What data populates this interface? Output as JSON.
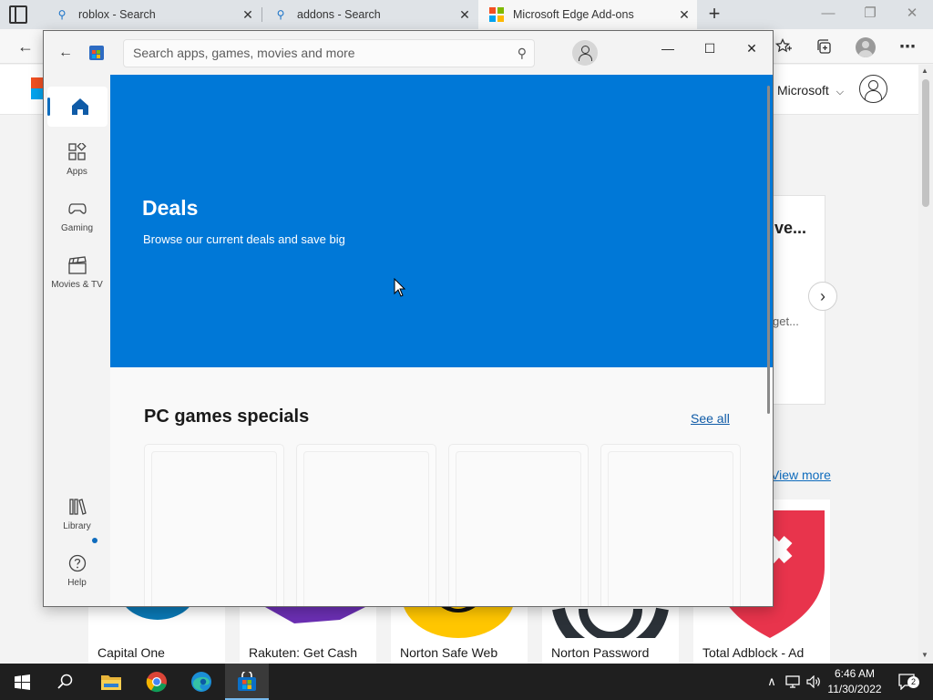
{
  "browser": {
    "tabs": [
      {
        "title": "roblox - Search",
        "active": false,
        "icon": "search-icon"
      },
      {
        "title": "addons - Search",
        "active": false,
        "icon": "search-icon"
      },
      {
        "title": "Microsoft Edge Add-ons",
        "active": true,
        "icon": "microsoft-logo-icon"
      }
    ],
    "tab_close_glyph": "✕",
    "new_tab_glyph": "+",
    "window_controls": {
      "minimize": "—",
      "restore": "❐",
      "close": "✕"
    },
    "toolbar_icons": [
      "favorites-icon",
      "collections-icon",
      "profile-avatar-icon",
      "more-menu-icon"
    ]
  },
  "webpage": {
    "signin_text": "l Microsoft",
    "signin_chevron": "⌵",
    "card_title": "ve...",
    "card_subtitle": "get...",
    "next_glyph": "›",
    "view_more": "View more",
    "extensions": [
      {
        "name": "Capital One"
      },
      {
        "name": "Rakuten: Get Cash"
      },
      {
        "name": "Norton Safe Web"
      },
      {
        "name": "Norton Password"
      },
      {
        "name": "Total Adblock - Ad"
      }
    ]
  },
  "store": {
    "search_placeholder": "Search apps, games, movies and more",
    "window_controls": {
      "minimize": "—",
      "maximize": "☐",
      "close": "✕"
    },
    "nav": [
      {
        "key": "home",
        "label": "",
        "icon": "home-icon",
        "active": true
      },
      {
        "key": "apps",
        "label": "Apps",
        "icon": "apps-icon",
        "active": false
      },
      {
        "key": "gaming",
        "label": "Gaming",
        "icon": "gamepad-icon",
        "active": false
      },
      {
        "key": "movies",
        "label": "Movies & TV",
        "icon": "clapperboard-icon",
        "active": false
      },
      {
        "key": "library",
        "label": "Library",
        "icon": "library-icon",
        "active": false
      },
      {
        "key": "help",
        "label": "Help",
        "icon": "help-icon",
        "active": false
      }
    ],
    "hero": {
      "title": "Deals",
      "subtitle": "Browse our current deals and save big",
      "color": "#0078d7"
    },
    "section": {
      "title": "PC games specials",
      "see_all": "See all"
    }
  },
  "taskbar": {
    "pinned": [
      "windows-start-icon",
      "search-icon",
      "file-explorer-icon",
      "chrome-icon",
      "edge-icon",
      "microsoft-store-icon"
    ],
    "active_app": "microsoft-store-icon",
    "tray": {
      "chevron": "∧",
      "notification_count": "2"
    },
    "clock": {
      "time": "6:46 AM",
      "date": "11/30/2022"
    }
  }
}
